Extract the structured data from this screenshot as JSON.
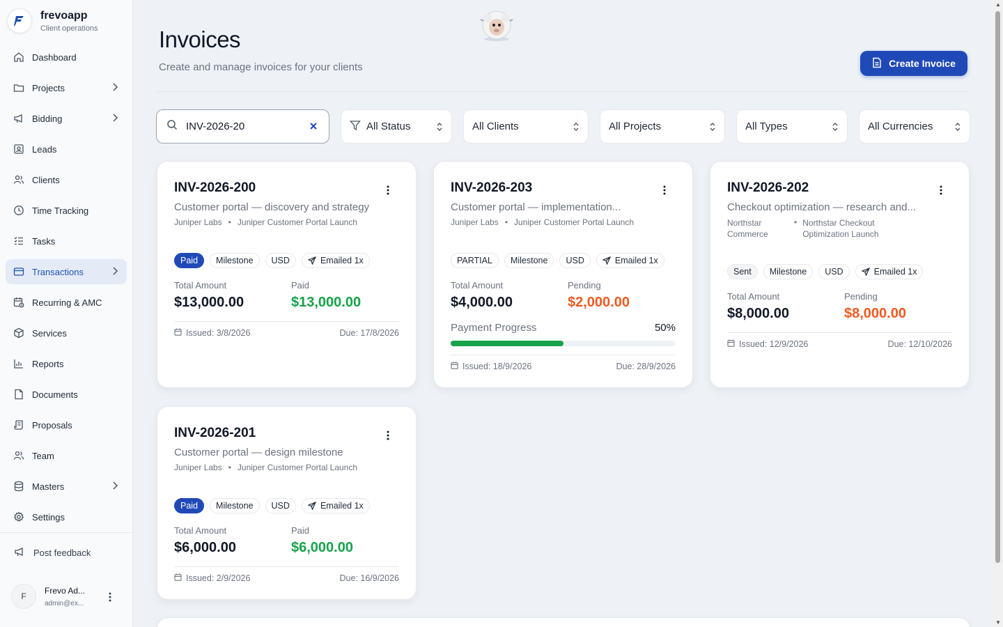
{
  "brand": {
    "name": "frevoapp",
    "subtitle": "Client operations"
  },
  "nav": [
    {
      "label": "Dashboard",
      "icon": "home-icon",
      "chevron": false,
      "active": false
    },
    {
      "label": "Projects",
      "icon": "folder-icon",
      "chevron": true,
      "active": false
    },
    {
      "label": "Bidding",
      "icon": "megaphone-icon",
      "chevron": true,
      "active": false
    },
    {
      "label": "Leads",
      "icon": "contact-icon",
      "chevron": false,
      "active": false
    },
    {
      "label": "Clients",
      "icon": "users-icon",
      "chevron": false,
      "active": false
    },
    {
      "label": "Time Tracking",
      "icon": "clock-icon",
      "chevron": false,
      "active": false
    },
    {
      "label": "Tasks",
      "icon": "list-check-icon",
      "chevron": false,
      "active": false
    },
    {
      "label": "Transactions",
      "icon": "credit-card-icon",
      "chevron": true,
      "active": true
    },
    {
      "label": "Recurring & AMC",
      "icon": "calendar-repeat-icon",
      "chevron": false,
      "active": false
    },
    {
      "label": "Services",
      "icon": "box-icon",
      "chevron": false,
      "active": false
    },
    {
      "label": "Reports",
      "icon": "bar-chart-icon",
      "chevron": false,
      "active": false
    },
    {
      "label": "Documents",
      "icon": "file-icon",
      "chevron": false,
      "active": false
    },
    {
      "label": "Proposals",
      "icon": "scroll-icon",
      "chevron": false,
      "active": false
    },
    {
      "label": "Team",
      "icon": "team-icon",
      "chevron": false,
      "active": false
    },
    {
      "label": "Masters",
      "icon": "database-icon",
      "chevron": true,
      "active": false
    },
    {
      "label": "Settings",
      "icon": "gear-icon",
      "chevron": false,
      "active": false
    }
  ],
  "feedback": {
    "label": "Post feedback"
  },
  "user": {
    "initial": "F",
    "name": "Frevo Ad...",
    "email": "admin@ex..."
  },
  "header": {
    "title": "Invoices",
    "subtitle": "Create and manage invoices for your clients",
    "create_label": "Create Invoice"
  },
  "filters": {
    "search_value": "INV-2026-20",
    "status": "All Status",
    "clients": "All Clients",
    "projects": "All Projects",
    "types": "All Types",
    "currencies": "All Currencies"
  },
  "colors": {
    "accent": "#2049b8",
    "paid": "#16a34a",
    "pending": "#f05a22",
    "active_nav_bg": "#e4ebf6"
  },
  "invoices": [
    {
      "id": "INV-2026-200",
      "description": "Customer portal — discovery and strategy",
      "client": "Juniper Labs",
      "project": "Juniper Customer Portal Launch",
      "status": "Paid",
      "type": "Milestone",
      "currency": "USD",
      "emailed": "Emailed 1x",
      "total_label": "Total Amount",
      "total": "$13,000.00",
      "second_label": "Paid",
      "second_value": "$13,000.00",
      "issued": "Issued: 3/8/2026",
      "due": "Due: 17/8/2026"
    },
    {
      "id": "INV-2026-203",
      "description": "Customer portal — implementation...",
      "client": "Juniper Labs",
      "project": "Juniper Customer Portal Launch",
      "status": "PARTIAL",
      "type": "Milestone",
      "currency": "USD",
      "emailed": "Emailed 1x",
      "total_label": "Total Amount",
      "total": "$4,000.00",
      "second_label": "Pending",
      "second_value": "$2,000.00",
      "progress_label": "Payment Progress",
      "progress_text": "50%",
      "progress": 0.5,
      "issued": "Issued: 18/9/2026",
      "due": "Due: 28/9/2026"
    },
    {
      "id": "INV-2026-202",
      "description": "Checkout optimization — research and...",
      "client": "Northstar Commerce",
      "project": "Northstar Checkout Optimization Launch",
      "status": "Sent",
      "type": "Milestone",
      "currency": "USD",
      "emailed": "Emailed 1x",
      "total_label": "Total Amount",
      "total": "$8,000.00",
      "second_label": "Pending",
      "second_value": "$8,000.00",
      "issued": "Issued: 12/9/2026",
      "due": "Due: 12/10/2026"
    },
    {
      "id": "INV-2026-201",
      "description": "Customer portal — design milestone",
      "client": "Juniper Labs",
      "project": "Juniper Customer Portal Launch",
      "status": "Paid",
      "type": "Milestone",
      "currency": "USD",
      "emailed": "Emailed 1x",
      "total_label": "Total Amount",
      "total": "$6,000.00",
      "second_label": "Paid",
      "second_value": "$6,000.00",
      "issued": "Issued: 2/9/2026",
      "due": "Due: 16/9/2026"
    }
  ]
}
